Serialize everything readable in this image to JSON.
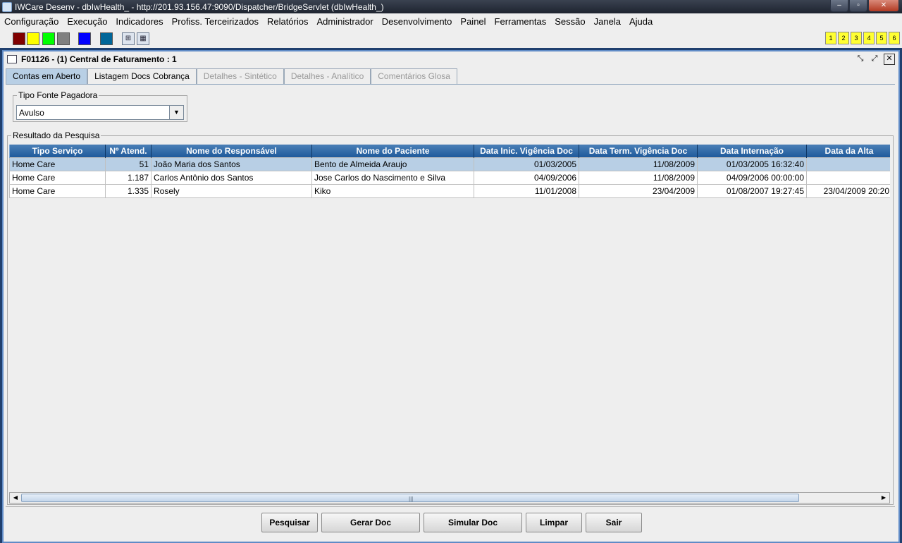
{
  "window": {
    "title": "IWCare Desenv - dbIwHealth_ - http://201.93.156.47:9090/Dispatcher/BridgeServlet (dbIwHealth_)",
    "minimize": "‒",
    "maximize": "▫",
    "close": "✕"
  },
  "menu": [
    "Configuração",
    "Execução",
    "Indicadores",
    "Profiss. Terceirizados",
    "Relatórios",
    "Administrador",
    "Desenvolvimento",
    "Painel",
    "Ferramentas",
    "Sessão",
    "Janela",
    "Ajuda"
  ],
  "toolbar": {
    "swatches": [
      "#800000",
      "#ffff00",
      "#00ff00",
      "#808080",
      "#0000ff",
      "#006699"
    ],
    "tool_icons": [
      "tree-icon",
      "grid-icon"
    ],
    "numbers": [
      "1",
      "2",
      "3",
      "4",
      "5",
      "6"
    ],
    "number_color": "#ffff33"
  },
  "frame": {
    "title": "F01126 - (1) Central de Faturamento : 1",
    "tabs": [
      {
        "label": "Contas em Aberto",
        "state": "active"
      },
      {
        "label": "Listagem Docs Cobrança",
        "state": "enabled"
      },
      {
        "label": "Detalhes - Sintético",
        "state": "disabled"
      },
      {
        "label": "Detalhes - Analítico",
        "state": "disabled"
      },
      {
        "label": "Comentários Glosa",
        "state": "disabled"
      }
    ]
  },
  "filter": {
    "label": "Tipo Fonte Pagadora",
    "value": "Avulso"
  },
  "results": {
    "label": "Resultado da Pesquisa",
    "columns": [
      "Tipo Serviço",
      "Nº Atend.",
      "Nome do Responsável",
      "Nome do Paciente",
      "Data Inic. Vigência Doc",
      "Data Term. Vigência Doc",
      "Data Internação",
      "Data da Alta"
    ],
    "rows": [
      [
        "Home Care",
        "51",
        "João Maria dos Santos",
        "Bento de Almeida Araujo",
        "01/03/2005",
        "11/08/2009",
        "01/03/2005 16:32:40",
        ""
      ],
      [
        "Home Care",
        "1.187",
        "Carlos Antônio dos Santos",
        "Jose Carlos do Nascimento e Silva",
        "04/09/2006",
        "11/08/2009",
        "04/09/2006 00:00:00",
        ""
      ],
      [
        "Home Care",
        "1.335",
        "Rosely",
        "Kiko",
        "11/01/2008",
        "23/04/2009",
        "01/08/2007 19:27:45",
        "23/04/2009 20:20"
      ]
    ],
    "selected_row": 0
  },
  "buttons": [
    "Pesquisar",
    "Gerar Doc",
    "Simular Doc",
    "Limpar",
    "Sair"
  ],
  "colors": {
    "header_bg": "#1f5a9b",
    "selected_row": "#b8cfe5",
    "frame_border": "#5f8bc6"
  }
}
